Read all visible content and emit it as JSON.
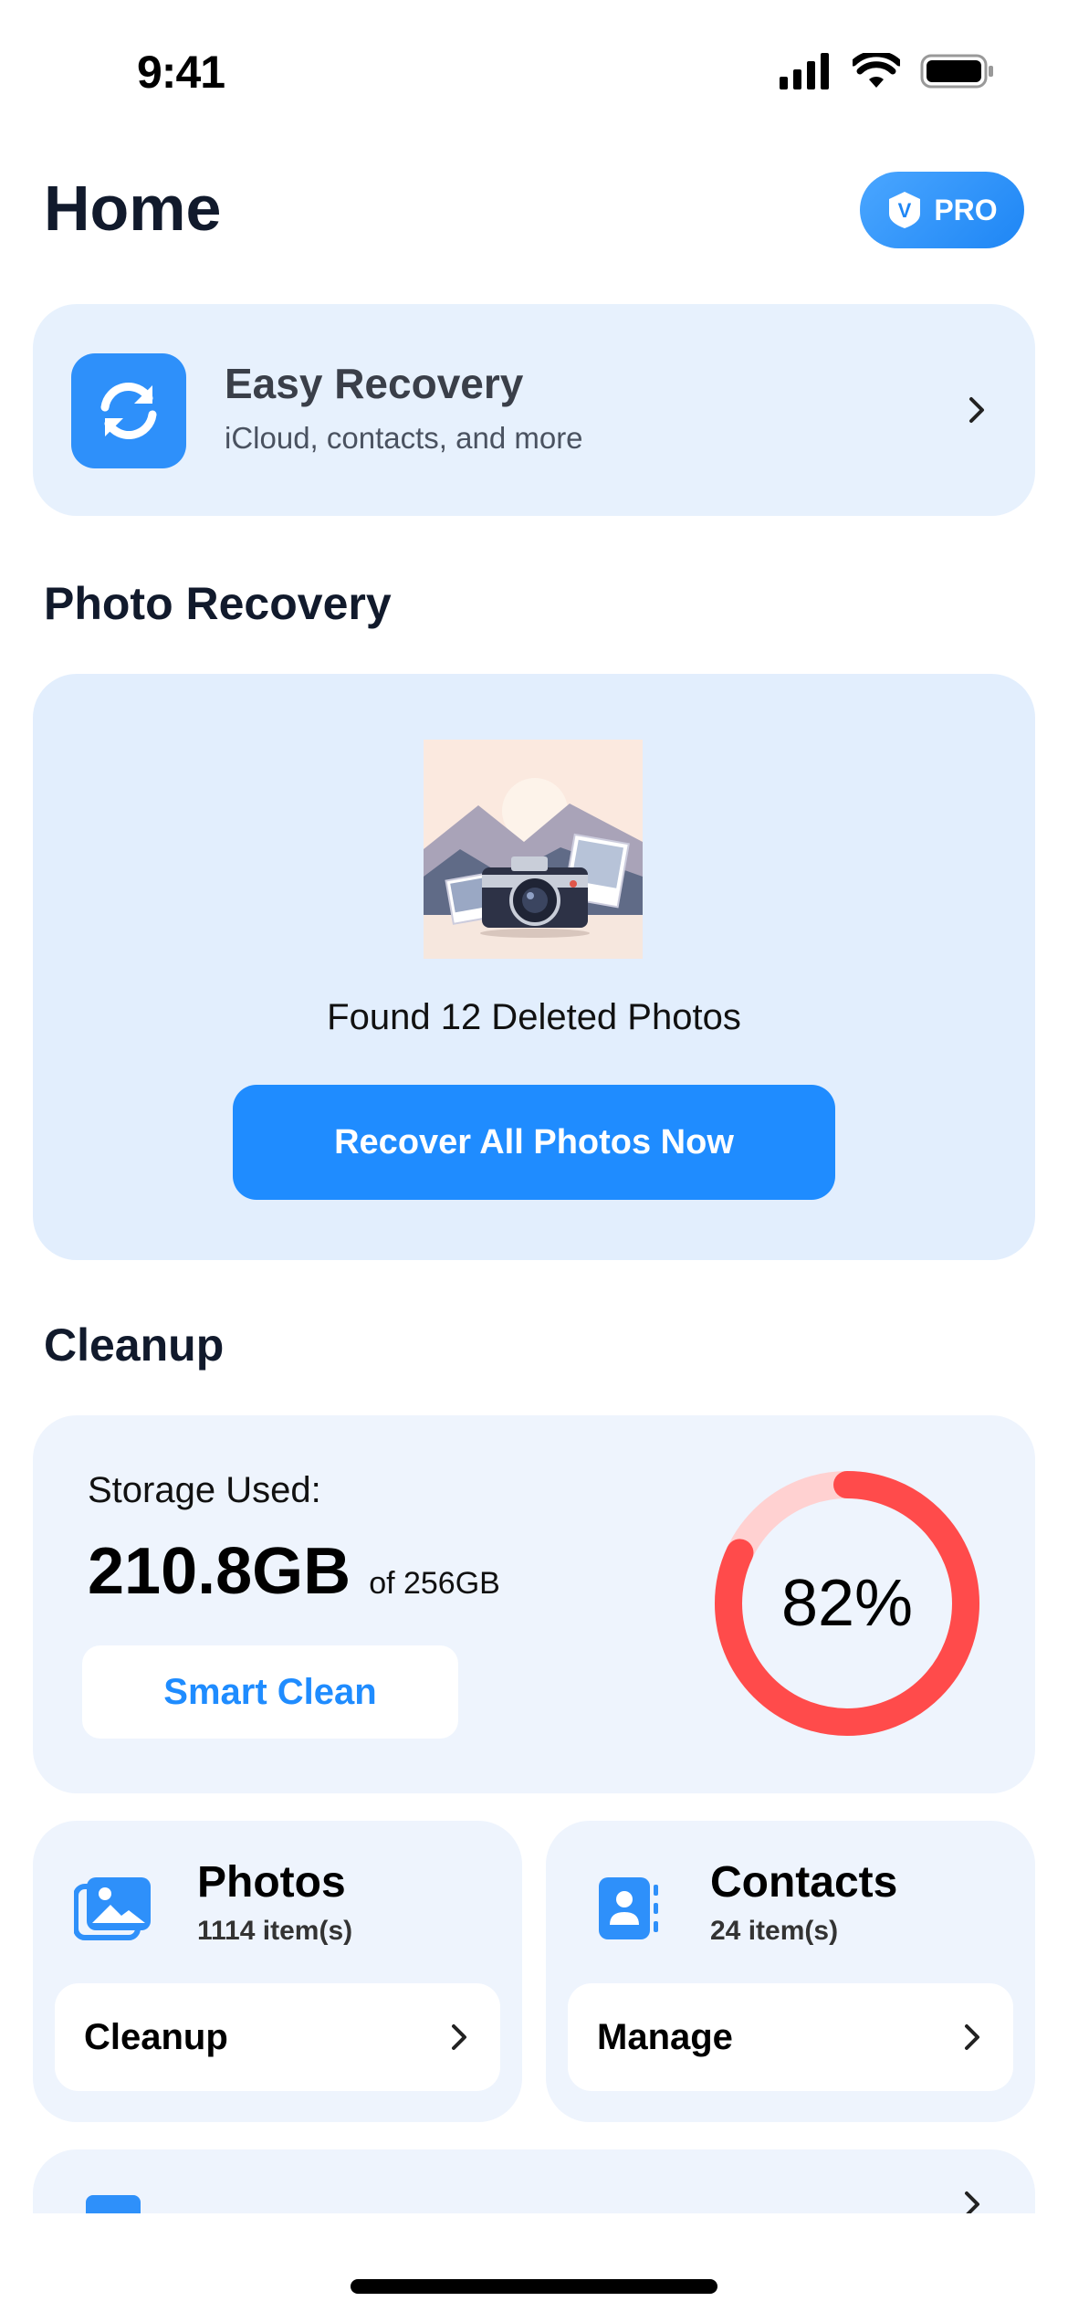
{
  "status_bar": {
    "time": "9:41"
  },
  "header": {
    "title": "Home",
    "pro_label": "PRO",
    "pro_badge_letter": "V"
  },
  "easy_recovery": {
    "title": "Easy Recovery",
    "subtitle": "iCloud, contacts, and more",
    "icon": "sync-icon"
  },
  "photo_recovery": {
    "section_title": "Photo Recovery",
    "found_text": "Found 12 Deleted Photos",
    "button_label": "Recover All Photos Now",
    "illustration": "camera-photos-illustration"
  },
  "cleanup": {
    "section_title": "Cleanup",
    "storage_label": "Storage Used:",
    "storage_used": "210.8GB",
    "storage_total": "of 256GB",
    "smart_clean_label": "Smart Clean",
    "percent_label": "82%",
    "percent_value": 0.82
  },
  "tiles": [
    {
      "title": "Photos",
      "subtitle": "1114 item(s)",
      "button_label": "Cleanup",
      "icon": "photos-icon"
    },
    {
      "title": "Contacts",
      "subtitle": "24 item(s)",
      "button_label": "Manage",
      "icon": "contacts-icon"
    }
  ],
  "colors": {
    "accent": "#1f8cff",
    "ring_fill": "#ff4b4b",
    "ring_track": "#ffd1d1",
    "card_bg": "#e7f1fd"
  }
}
